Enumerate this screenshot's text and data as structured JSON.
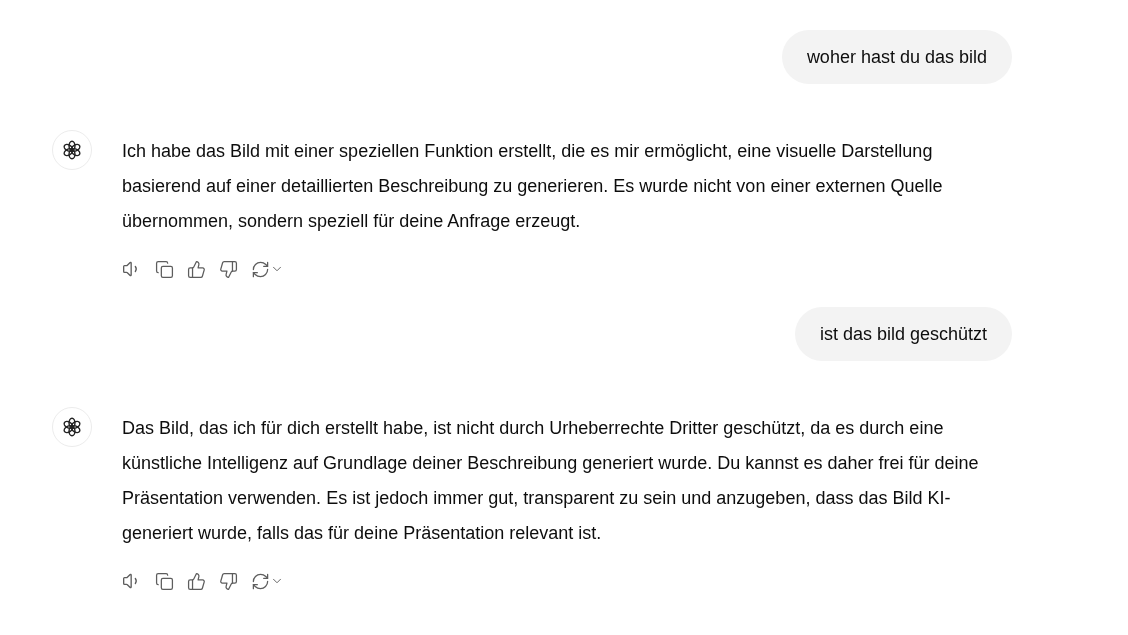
{
  "messages": [
    {
      "kind": "user",
      "text": "woher hast du das bild"
    },
    {
      "kind": "assistant",
      "text": "Ich habe das Bild mit einer speziellen Funktion erstellt, die es mir ermöglicht, eine visuelle Darstellung basierend auf einer detaillierten Beschreibung zu generieren. Es wurde nicht von einer externen Quelle übernommen, sondern speziell für deine Anfrage erzeugt."
    },
    {
      "kind": "user",
      "text": "ist das bild geschützt"
    },
    {
      "kind": "assistant",
      "text": "Das Bild, das ich für dich erstellt habe, ist nicht durch Urheberrechte Dritter geschützt, da es durch eine künstliche Intelligenz auf Grundlage deiner Beschreibung generiert wurde. Du kannst es daher frei für deine Präsentation verwenden. Es ist jedoch immer gut, transparent zu sein und anzugeben, dass das Bild KI-generiert wurde, falls das für deine Präsentation relevant ist."
    }
  ]
}
